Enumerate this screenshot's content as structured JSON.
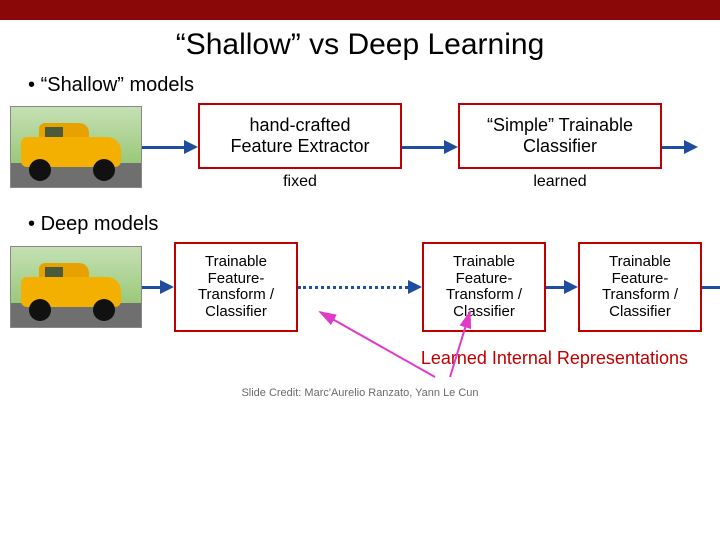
{
  "title": "“Shallow” vs Deep Learning",
  "bullets": {
    "shallow": "“Shallow” models",
    "deep": "Deep models"
  },
  "shallow": {
    "box1": {
      "line1": "hand-crafted",
      "line2": "Feature Extractor"
    },
    "below1": "fixed",
    "box2": {
      "line1": "“Simple” Trainable",
      "line2": "Classifier"
    },
    "below2": "learned"
  },
  "deep": {
    "box1": {
      "l1": "Trainable",
      "l2": "Feature-",
      "l3": "Transform /",
      "l4": "Classifier"
    },
    "box2": {
      "l1": "Trainable",
      "l2": "Feature-",
      "l3": "Transform /",
      "l4": "Classifier"
    },
    "box3": {
      "l1": "Trainable",
      "l2": "Feature-",
      "l3": "Transform /",
      "l4": "Classifier"
    }
  },
  "red_caption": "Learned Internal Representations",
  "credit": "Slide Credit: Marc'Aurelio Ranzato, Yann Le Cun"
}
